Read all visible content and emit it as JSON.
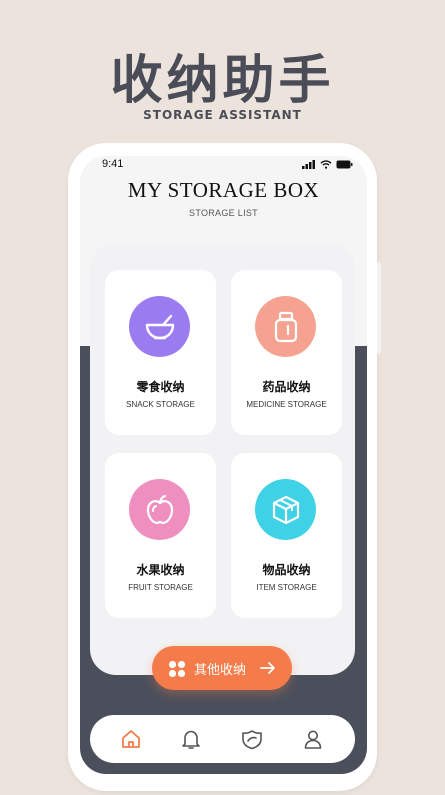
{
  "promo": {
    "title": "收纳助手",
    "subtitle": "STORAGE ASSISTANT"
  },
  "status_bar": {
    "time": "9:41"
  },
  "header": {
    "title": "MY STORAGE BOX",
    "subtitle": "STORAGE LIST"
  },
  "cards": [
    {
      "cn": "零食收纳",
      "en": "SNACK STORAGE",
      "icon": "bowl-icon",
      "color": "#9b7cf0"
    },
    {
      "cn": "药品收纳",
      "en": "MEDICINE STORAGE",
      "icon": "medicine-jar-icon",
      "color": "#f5a390"
    },
    {
      "cn": "水果收纳",
      "en": "FRUIT STORAGE",
      "icon": "apple-icon",
      "color": "#ee8fbf"
    },
    {
      "cn": "物品收纳",
      "en": "ITEM STORAGE",
      "icon": "box-icon",
      "color": "#3fd2e6"
    }
  ],
  "other_button": {
    "label": "其他收纳",
    "color": "#f47c4b"
  },
  "tabs": [
    {
      "name": "home-icon",
      "active": true
    },
    {
      "name": "bell-icon",
      "active": false
    },
    {
      "name": "shield-icon",
      "active": false
    },
    {
      "name": "user-icon",
      "active": false
    }
  ],
  "colors": {
    "background": "#ece4dc",
    "dark_panel": "#4b4f5c",
    "accent": "#f47c4b"
  }
}
